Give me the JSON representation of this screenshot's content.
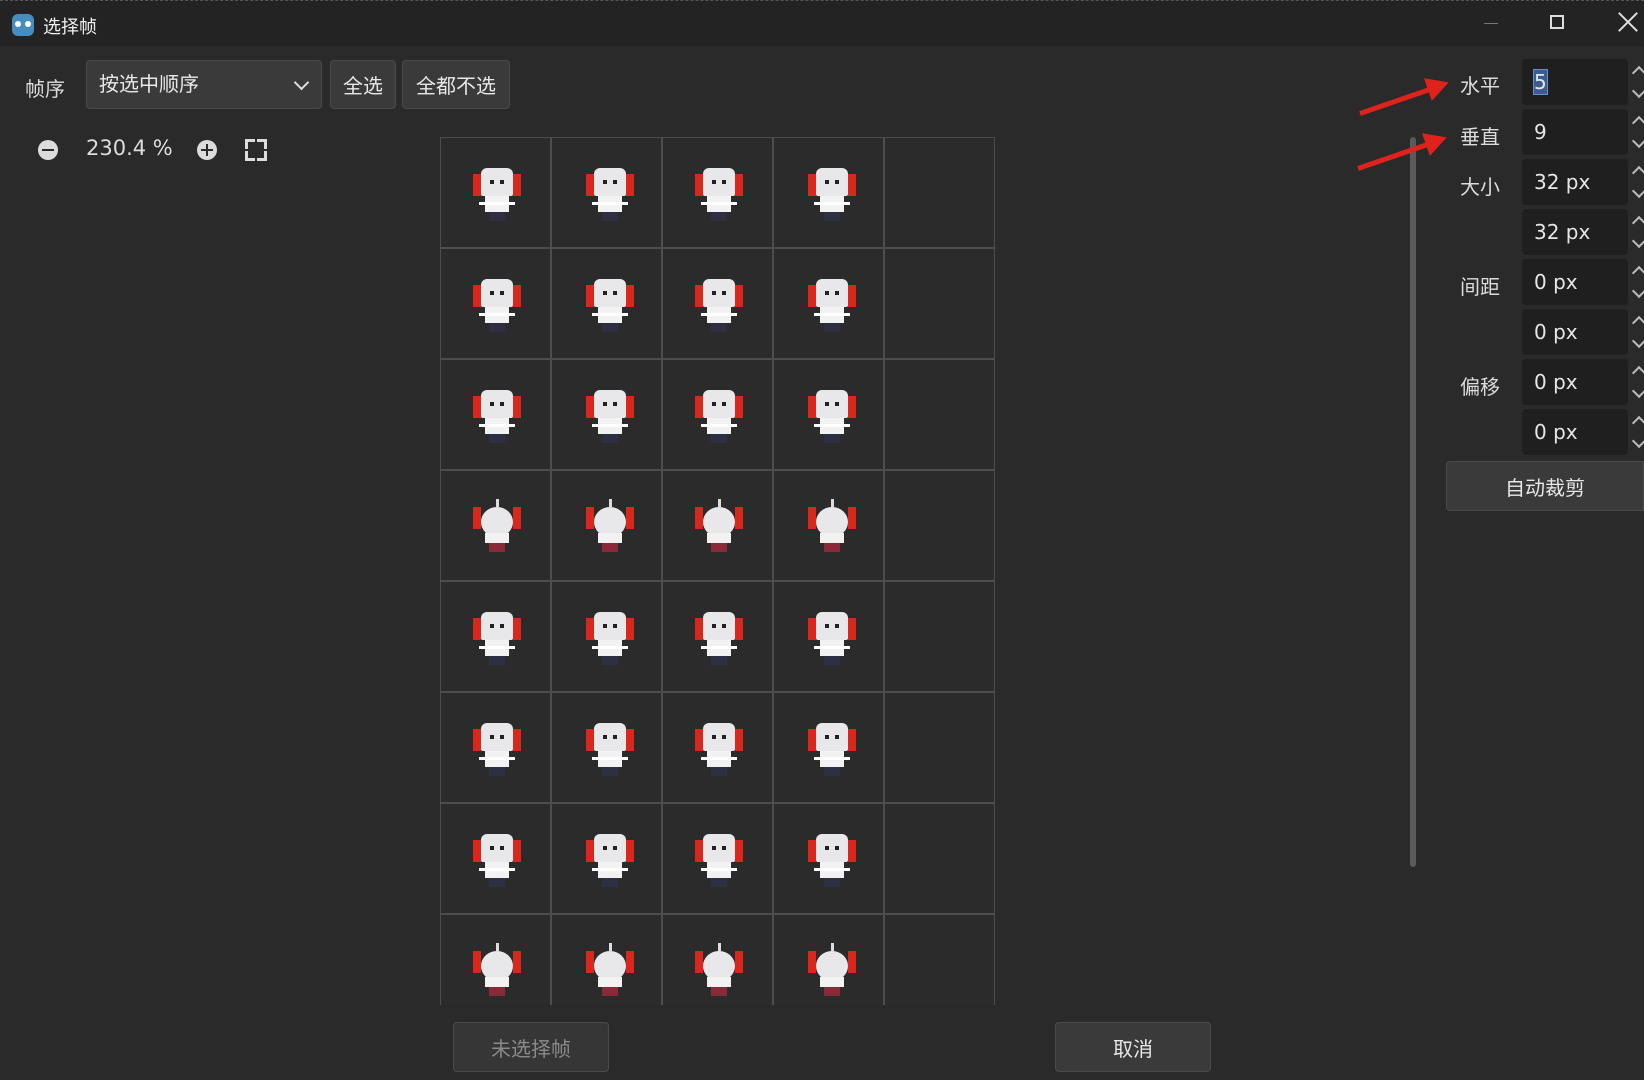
{
  "window": {
    "title": "选择帧",
    "controls": [
      "minimize-icon",
      "maximize-icon",
      "close-icon"
    ]
  },
  "toolbar": {
    "frame_order_label": "帧序",
    "frame_order_value": "按选中顺序",
    "select_all_label": "全选",
    "select_none_label": "全都不选"
  },
  "zoom": {
    "zoom_out_icon": "zoom-out-icon",
    "level": "230.4 %",
    "zoom_in_icon": "zoom-in-icon",
    "fit_icon": "fit-view-icon"
  },
  "settings": {
    "horizontal_label": "水平",
    "horizontal_value": "5",
    "vertical_label": "垂直",
    "vertical_value": "9",
    "size_label": "大小",
    "size_x": "32 px",
    "size_y": "32 px",
    "separation_label": "间距",
    "separation_x": "0 px",
    "separation_y": "0 px",
    "offset_label": "偏移",
    "offset_x": "0 px",
    "offset_y": "0 px",
    "auto_slice_label": "自动裁剪"
  },
  "footer": {
    "add_frames_label": "未选择帧",
    "cancel_label": "取消"
  },
  "sprite_grid": {
    "columns": 5,
    "visible_rows": 8,
    "rows": [
      {
        "pose": "front-weapon",
        "frames": 4
      },
      {
        "pose": "front-attack",
        "frames": 4
      },
      {
        "pose": "front-idle",
        "frames": 4
      },
      {
        "pose": "back",
        "frames": 4
      },
      {
        "pose": "front-weapon",
        "frames": 4
      },
      {
        "pose": "front-attack",
        "frames": 4
      },
      {
        "pose": "front-idle",
        "frames": 4
      },
      {
        "pose": "back",
        "frames": 4
      }
    ]
  },
  "colors": {
    "background": "#2a2a2a",
    "titlebar": "#232323",
    "annotation_arrow": "#e0221c",
    "selection": "#3b5d8e"
  }
}
